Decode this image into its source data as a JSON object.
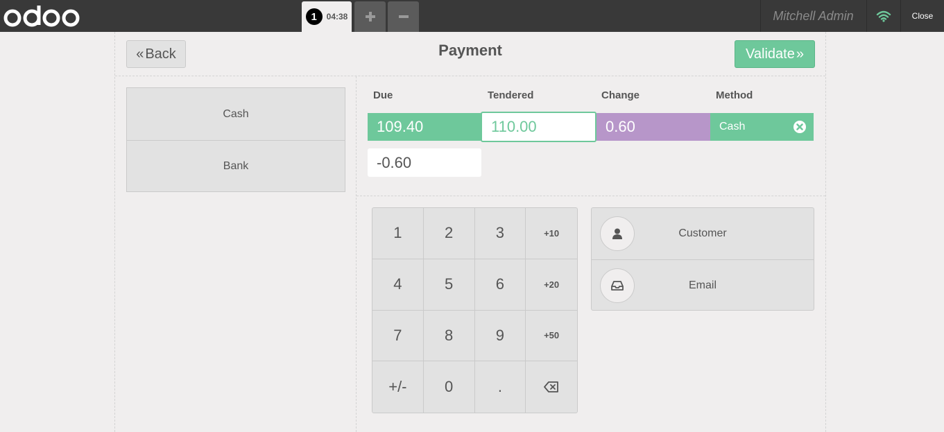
{
  "topbar": {
    "logo_text": "odoo",
    "order": {
      "number": "1",
      "time": "04:38"
    },
    "add_order_symbol": "+",
    "remove_order_symbol": "−",
    "username": "Mitchell Admin",
    "close_label": "Close",
    "wifi_icon": "wifi-icon",
    "colors": {
      "bar": "#393939",
      "wifi": "#6ec89b"
    }
  },
  "header": {
    "back_chevron": "«",
    "back_label": "Back",
    "title": "Payment",
    "validate_label": "Validate",
    "validate_chevron": "»"
  },
  "payment_methods": [
    {
      "label": "Cash"
    },
    {
      "label": "Bank"
    }
  ],
  "paymentlines": {
    "headers": {
      "due": "Due",
      "tendered": "Tendered",
      "change": "Change",
      "method": "Method"
    },
    "line": {
      "due": "109.40",
      "tendered": "110.00",
      "change": "0.60",
      "method": "Cash"
    },
    "remaining": "-0.60"
  },
  "numpad": {
    "keys": [
      "1",
      "2",
      "3",
      "+10",
      "4",
      "5",
      "6",
      "+20",
      "7",
      "8",
      "9",
      "+50",
      "+/-",
      "0",
      ".",
      "backspace-icon"
    ]
  },
  "actions": {
    "customer_label": "Customer",
    "email_label": "Email"
  },
  "colors": {
    "accent_green": "#6ec89b",
    "change_purple": "#b796c9",
    "background": "#f0eeee"
  }
}
